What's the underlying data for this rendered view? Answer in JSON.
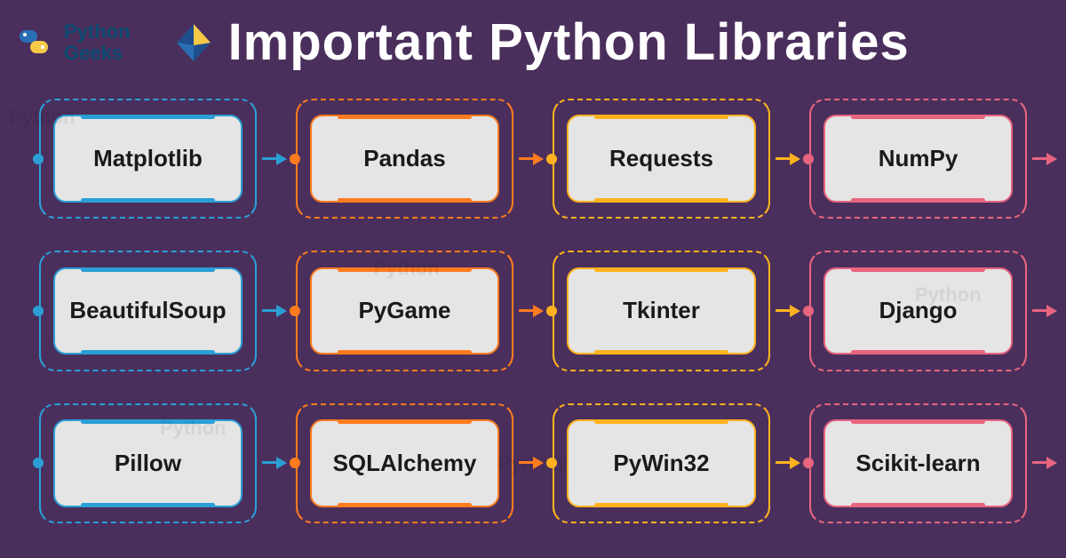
{
  "brand": {
    "line1": "Python",
    "line2": "Geeks"
  },
  "title": "Important Python Libraries",
  "columns": [
    {
      "color": "#2a9fd6"
    },
    {
      "color": "#ff7b1f"
    },
    {
      "color": "#ffb21e"
    },
    {
      "color": "#e8657f"
    }
  ],
  "libraries": [
    [
      "Matplotlib",
      "Pandas",
      "Requests",
      "NumPy"
    ],
    [
      "BeautifulSoup",
      "PyGame",
      "Tkinter",
      "Django"
    ],
    [
      "Pillow",
      "SQLAlchemy",
      "PyWin32",
      "Scikit-learn"
    ]
  ],
  "icons": {
    "brand_logo": "python-geeks-logo-icon",
    "title_logo": "diamond-logo-icon"
  }
}
